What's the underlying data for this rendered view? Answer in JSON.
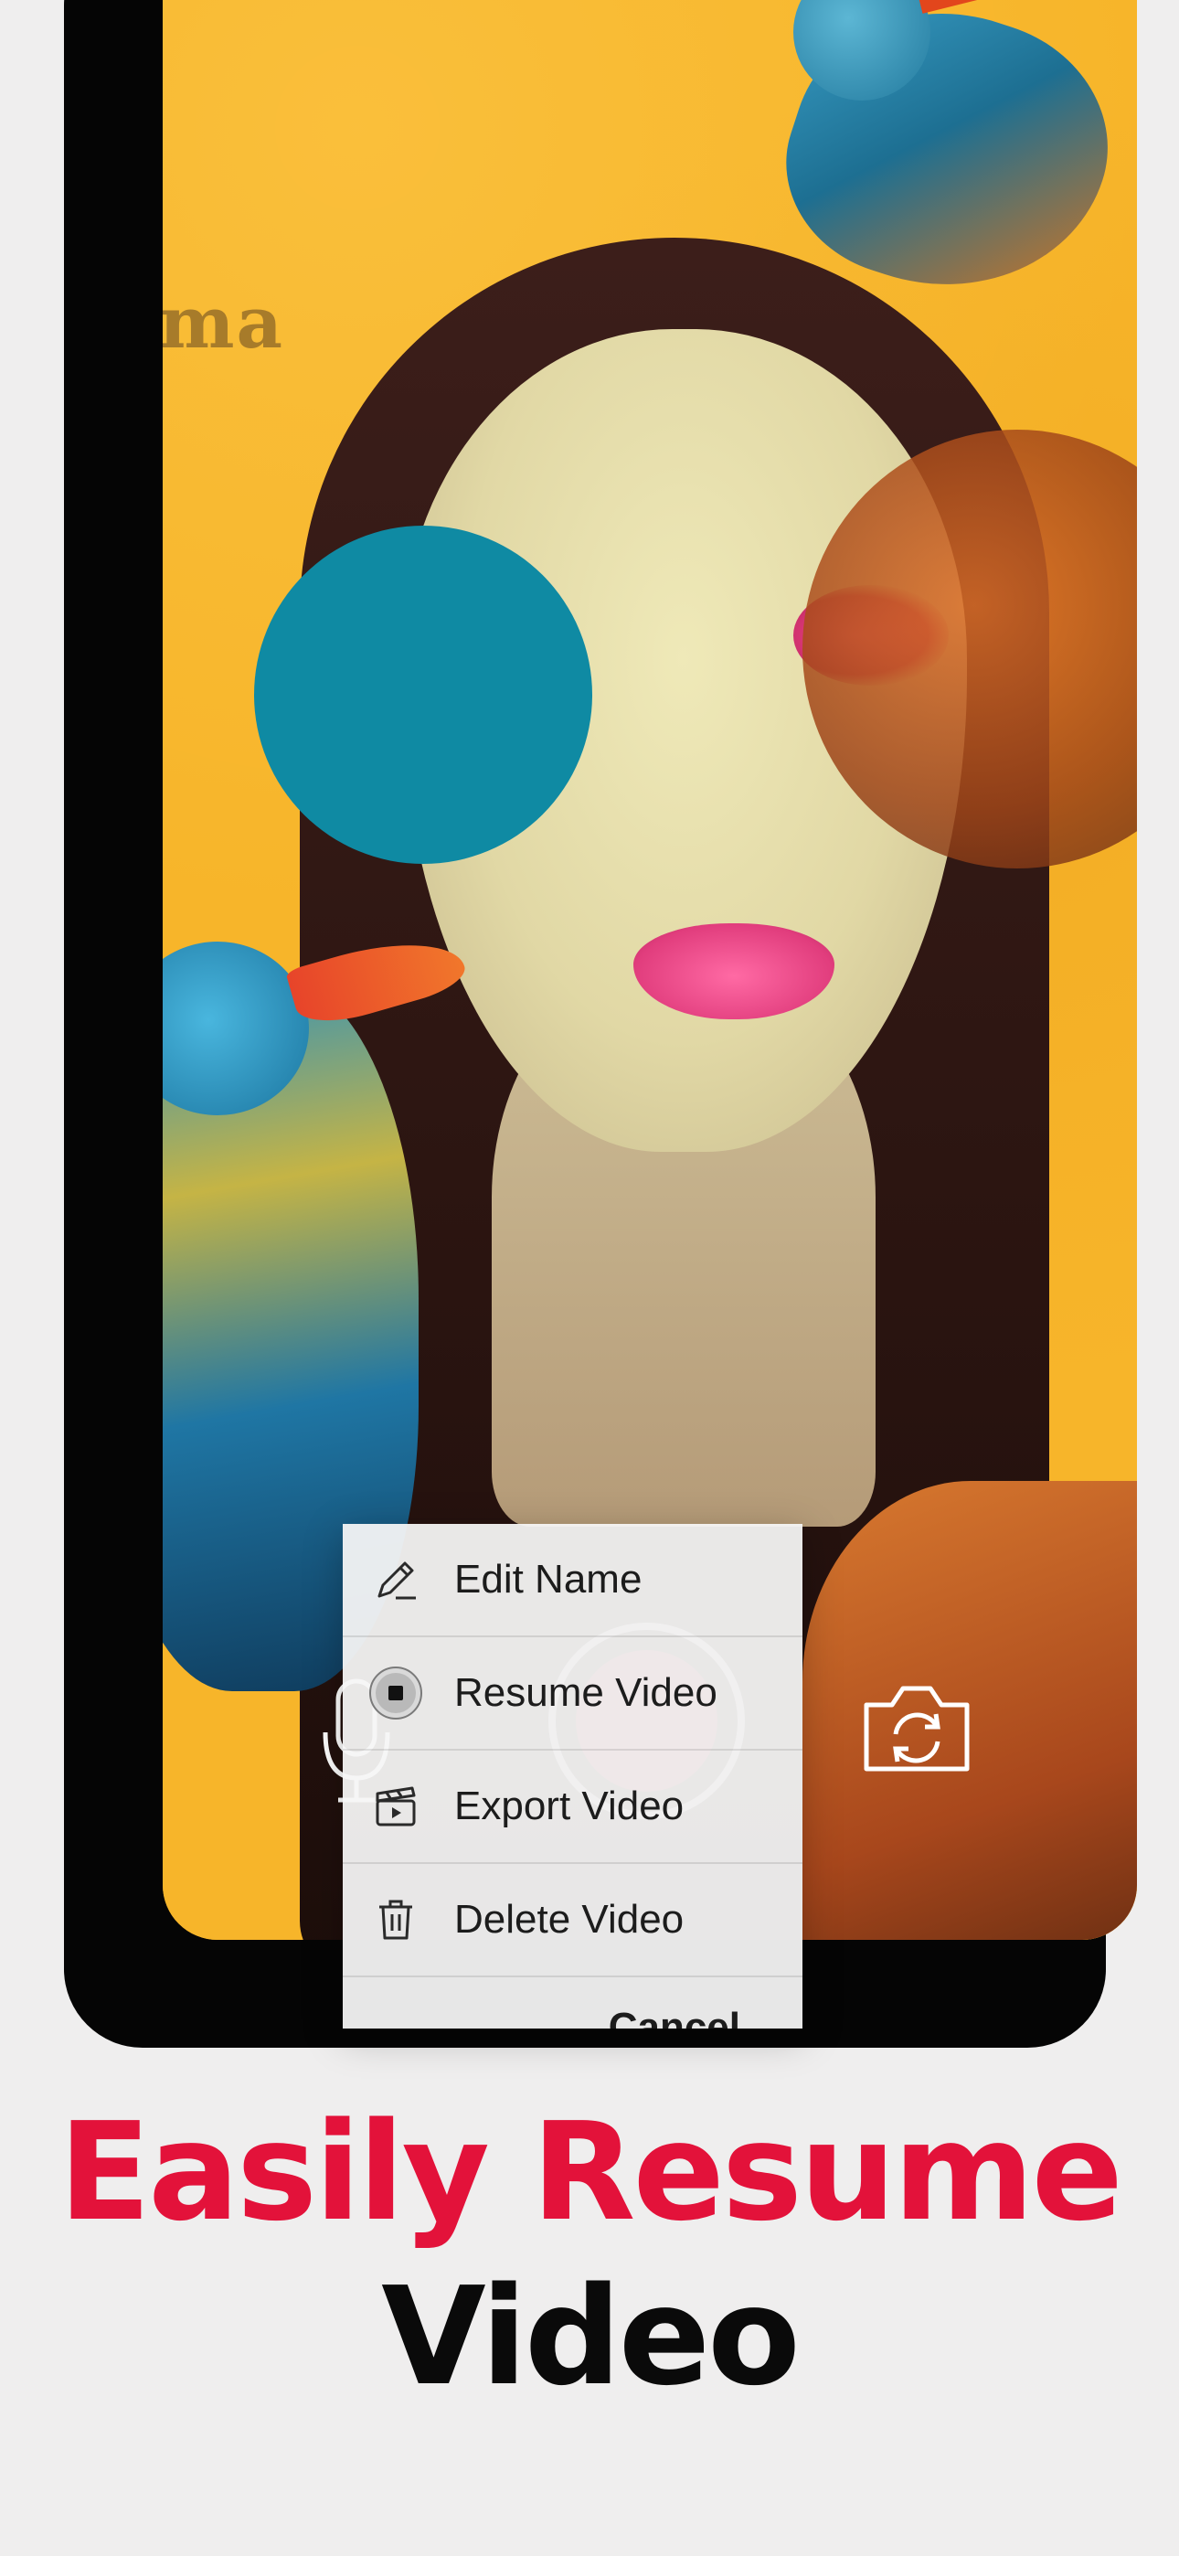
{
  "background_artwork": {
    "text_fragment": "ma"
  },
  "context_menu": {
    "items": [
      {
        "label": "Edit Name",
        "icon": "pencil-icon"
      },
      {
        "label": "Resume Video",
        "icon": "resume-record-icon"
      },
      {
        "label": "Export Video",
        "icon": "clapperboard-icon"
      },
      {
        "label": "Delete Video",
        "icon": "trash-icon"
      }
    ],
    "cancel_label": "Cancel"
  },
  "camera_controls": {
    "left_icon": "microphone-icon",
    "center_icon": "record-button",
    "right_icon": "camera-flip-icon"
  },
  "headline": {
    "line1": "Easily Resume",
    "line2": "Video",
    "line1_color": "#e3123a",
    "line2_color": "#0a0a0a"
  }
}
